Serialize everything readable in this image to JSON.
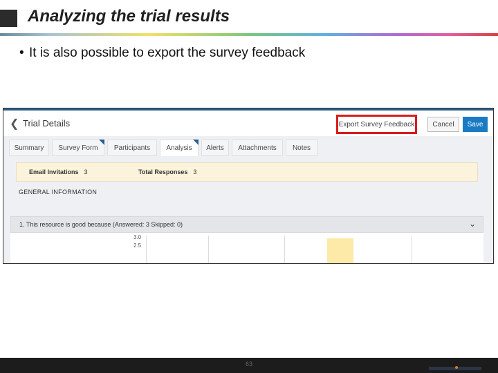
{
  "slide": {
    "title": "Analyzing the trial results",
    "bullet": "It is also possible to export the survey feedback",
    "page_number": "63"
  },
  "app": {
    "back_glyph": "❮",
    "page_title": "Trial Details",
    "buttons": {
      "export": "Export Survey Feedback",
      "cancel": "Cancel",
      "save": "Save"
    },
    "tabs": [
      {
        "label": "Summary"
      },
      {
        "label": "Survey Form"
      },
      {
        "label": "Participants"
      },
      {
        "label": "Analysis"
      },
      {
        "label": "Alerts"
      },
      {
        "label": "Attachments"
      },
      {
        "label": "Notes"
      }
    ],
    "active_tab": "Analysis",
    "info": {
      "email_label": "Email Invitations",
      "email_value": "3",
      "responses_label": "Total Responses",
      "responses_value": "3"
    },
    "section_title": "GENERAL INFORMATION",
    "question": "1. This resource is good because (Answered: 3 Skipped: 0)",
    "chevron_glyph": "⌄",
    "chart_ticks": [
      "3.0",
      "2.5"
    ]
  },
  "colors": {
    "accent": "#2b5f8a",
    "highlight_box": "#d81c1c",
    "save_button": "#1a7bc4",
    "info_bar": "#fbf3dc",
    "chart_bar": "#fde9a8"
  }
}
